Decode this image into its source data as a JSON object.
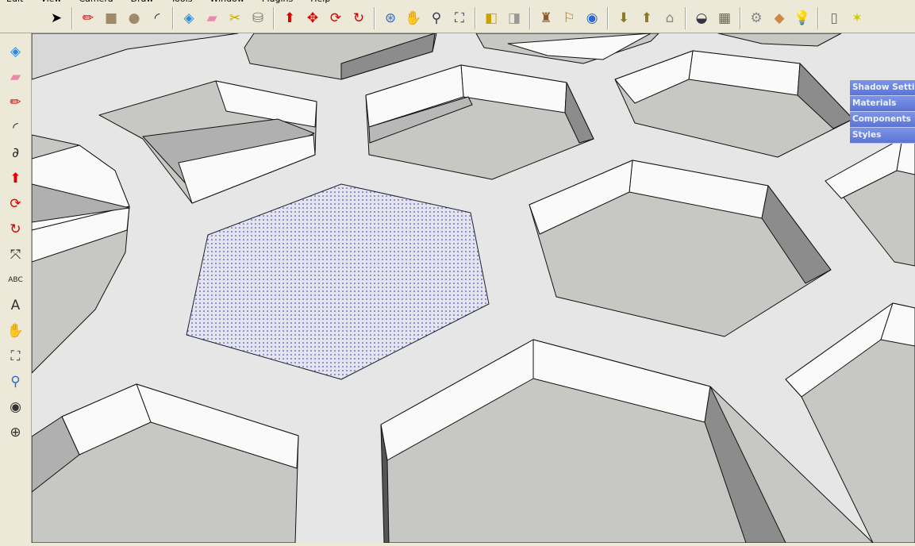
{
  "menu": [
    "Edit",
    "View",
    "Camera",
    "Draw",
    "Tools",
    "Window",
    "Plugins",
    "Help"
  ],
  "toolbar": [
    {
      "name": "select-icon",
      "glyph": "➤",
      "color": "#000"
    },
    {
      "sep": true
    },
    {
      "name": "pencil-icon",
      "glyph": "✏",
      "color": "#c00"
    },
    {
      "name": "rectangle-icon",
      "glyph": "■",
      "color": "#a08a6a"
    },
    {
      "name": "circle-icon",
      "glyph": "●",
      "color": "#a08a6a"
    },
    {
      "name": "arc-icon",
      "glyph": "◜",
      "color": "#222"
    },
    {
      "sep": true
    },
    {
      "name": "make-component-icon",
      "glyph": "◈",
      "color": "#2a8ae0"
    },
    {
      "name": "eraser-icon",
      "glyph": "▰",
      "color": "#e88aa8"
    },
    {
      "name": "tape-measure-icon",
      "glyph": "✂",
      "color": "#c9a400"
    },
    {
      "name": "paint-bucket-icon",
      "glyph": "⛁",
      "color": "#777"
    },
    {
      "sep": true
    },
    {
      "name": "push-pull-icon",
      "glyph": "⬆",
      "color": "#d00"
    },
    {
      "name": "move-icon",
      "glyph": "✥",
      "color": "#d00"
    },
    {
      "name": "rotate-icon",
      "glyph": "⟳",
      "color": "#d00"
    },
    {
      "name": "follow-me-icon",
      "glyph": "↻",
      "color": "#c00"
    },
    {
      "sep": true
    },
    {
      "name": "orbit-icon",
      "glyph": "⊛",
      "color": "#2a6ad0"
    },
    {
      "name": "pan-icon",
      "glyph": "✋",
      "color": "#555"
    },
    {
      "name": "zoom-icon",
      "glyph": "⚲",
      "color": "#335"
    },
    {
      "name": "zoom-extents-icon",
      "glyph": "⛶",
      "color": "#335"
    },
    {
      "sep": true
    },
    {
      "name": "previous-view-icon",
      "glyph": "◧",
      "color": "#c9a400"
    },
    {
      "name": "next-view-icon",
      "glyph": "◨",
      "color": "#999"
    },
    {
      "sep": true
    },
    {
      "name": "place-model-icon",
      "glyph": "♜",
      "color": "#8a5a2a"
    },
    {
      "name": "get-models-icon",
      "glyph": "⚐",
      "color": "#c87800"
    },
    {
      "name": "google-earth-icon",
      "glyph": "◉",
      "color": "#2a6ad0"
    },
    {
      "sep": true
    },
    {
      "name": "get-current-view-icon",
      "glyph": "⬇",
      "color": "#8a7a2a"
    },
    {
      "name": "toggle-terrain-icon",
      "glyph": "⬆",
      "color": "#8a7a2a"
    },
    {
      "name": "share-model-icon",
      "glyph": "⌂",
      "color": "#888"
    },
    {
      "sep": true
    },
    {
      "name": "shadows-icon",
      "glyph": "◒",
      "color": "#334"
    },
    {
      "name": "styles-icon",
      "glyph": "▦",
      "color": "#665"
    },
    {
      "sep": true
    },
    {
      "name": "settings-icon",
      "glyph": "⚙",
      "color": "#888"
    },
    {
      "name": "materials-icon",
      "glyph": "◆",
      "color": "#c84"
    },
    {
      "name": "lightbulb-icon",
      "glyph": "💡",
      "color": "#ee0"
    },
    {
      "sep": true
    },
    {
      "name": "outliner-icon",
      "glyph": "▯",
      "color": "#666"
    },
    {
      "name": "axes-icon",
      "glyph": "✶",
      "color": "#cc0"
    }
  ],
  "lefttools": [
    {
      "name": "make-component-icon",
      "glyph": "◈",
      "color": "#2a8ae0"
    },
    {
      "name": "eraser-icon",
      "glyph": "▰",
      "color": "#e88aa8"
    },
    {
      "name": "pencil-icon",
      "glyph": "✏",
      "color": "#c00"
    },
    {
      "name": "arc-icon",
      "glyph": "◜",
      "color": "#222"
    },
    {
      "name": "freehand-icon",
      "glyph": "∂",
      "color": "#222"
    },
    {
      "name": "push-pull-icon",
      "glyph": "⬆",
      "color": "#d00"
    },
    {
      "name": "rotate-icon",
      "glyph": "⟳",
      "color": "#d00"
    },
    {
      "name": "follow-me-icon",
      "glyph": "↻",
      "color": "#c00"
    },
    {
      "name": "dimension-icon",
      "glyph": "⤧",
      "color": "#222"
    },
    {
      "name": "text-label-icon",
      "glyph": "ABC",
      "color": "#222"
    },
    {
      "name": "3d-text-icon",
      "glyph": "A",
      "color": "#333"
    },
    {
      "name": "pan-icon",
      "glyph": "✋",
      "color": "#555"
    },
    {
      "name": "zoom-extents-icon",
      "glyph": "⛶",
      "color": "#335"
    },
    {
      "name": "position-camera-icon",
      "glyph": "⚲",
      "color": "#2a6ad0"
    },
    {
      "name": "look-around-icon",
      "glyph": "◉",
      "color": "#333"
    },
    {
      "name": "section-plane-icon",
      "glyph": "⊕",
      "color": "#333"
    }
  ],
  "trays": [
    "Shadow Settings",
    "Materials",
    "Components",
    "Styles"
  ],
  "colors": {
    "ground": "#e6e6e6",
    "floor": "#c7c7c4",
    "wall": "#fafafa",
    "darkwall": "#8c8c8c",
    "selection": "#2a2ab0",
    "tray": "#6a82de"
  }
}
